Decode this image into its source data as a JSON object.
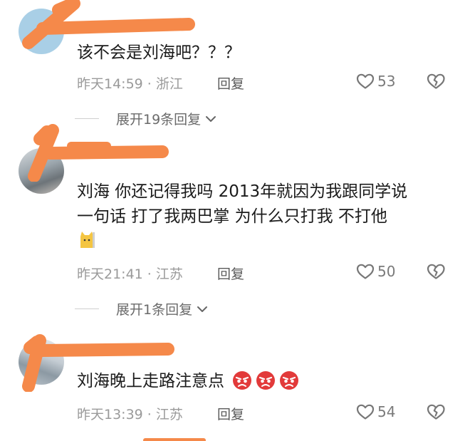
{
  "comments": [
    {
      "text": "该不会是刘海吧？？？",
      "time": "昨天14:59",
      "location": "浙江",
      "reply_label": "回复",
      "likes": "53",
      "expand_label": "展开19条回复"
    },
    {
      "text_line1": "刘海  你还记得我吗  2013年就因为我跟同学说",
      "text_line2": "一句话  打了我两巴掌  为什么只打我  不打他",
      "time": "昨天21:41",
      "location": "江苏",
      "reply_label": "回复",
      "likes": "50",
      "expand_label": "展开1条回复"
    },
    {
      "text": "刘海晚上走路注意点",
      "time": "昨天13:39",
      "location": "江苏",
      "reply_label": "回复",
      "likes": "54"
    }
  ],
  "meta_separator": "·",
  "icons": {
    "like": "heart-outline-icon",
    "dislike": "broken-heart-icon",
    "expand": "chevron-down-icon",
    "emoji": "angry-face-emoji"
  },
  "colors": {
    "redaction": "#f5894a",
    "meta_text": "#9a9a9a",
    "body_text": "#1b1b1b"
  }
}
